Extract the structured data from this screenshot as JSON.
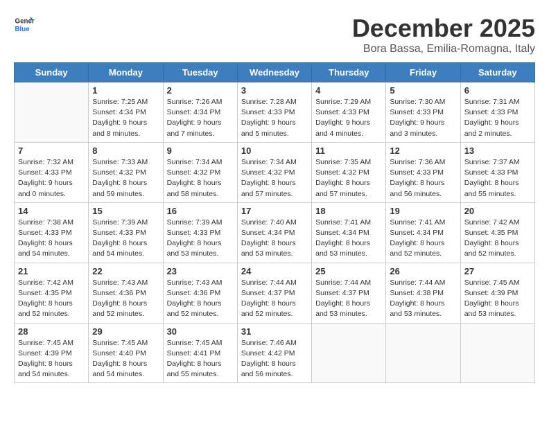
{
  "logo": {
    "line1": "General",
    "line2": "Blue"
  },
  "title": "December 2025",
  "subtitle": "Bora Bassa, Emilia-Romagna, Italy",
  "days_of_week": [
    "Sunday",
    "Monday",
    "Tuesday",
    "Wednesday",
    "Thursday",
    "Friday",
    "Saturday"
  ],
  "weeks": [
    [
      {
        "day": "",
        "info": ""
      },
      {
        "day": "1",
        "info": "Sunrise: 7:25 AM\nSunset: 4:34 PM\nDaylight: 9 hours\nand 8 minutes."
      },
      {
        "day": "2",
        "info": "Sunrise: 7:26 AM\nSunset: 4:34 PM\nDaylight: 9 hours\nand 7 minutes."
      },
      {
        "day": "3",
        "info": "Sunrise: 7:28 AM\nSunset: 4:33 PM\nDaylight: 9 hours\nand 5 minutes."
      },
      {
        "day": "4",
        "info": "Sunrise: 7:29 AM\nSunset: 4:33 PM\nDaylight: 9 hours\nand 4 minutes."
      },
      {
        "day": "5",
        "info": "Sunrise: 7:30 AM\nSunset: 4:33 PM\nDaylight: 9 hours\nand 3 minutes."
      },
      {
        "day": "6",
        "info": "Sunrise: 7:31 AM\nSunset: 4:33 PM\nDaylight: 9 hours\nand 2 minutes."
      }
    ],
    [
      {
        "day": "7",
        "info": "Sunrise: 7:32 AM\nSunset: 4:33 PM\nDaylight: 9 hours\nand 0 minutes."
      },
      {
        "day": "8",
        "info": "Sunrise: 7:33 AM\nSunset: 4:32 PM\nDaylight: 8 hours\nand 59 minutes."
      },
      {
        "day": "9",
        "info": "Sunrise: 7:34 AM\nSunset: 4:32 PM\nDaylight: 8 hours\nand 58 minutes."
      },
      {
        "day": "10",
        "info": "Sunrise: 7:34 AM\nSunset: 4:32 PM\nDaylight: 8 hours\nand 57 minutes."
      },
      {
        "day": "11",
        "info": "Sunrise: 7:35 AM\nSunset: 4:32 PM\nDaylight: 8 hours\nand 57 minutes."
      },
      {
        "day": "12",
        "info": "Sunrise: 7:36 AM\nSunset: 4:33 PM\nDaylight: 8 hours\nand 56 minutes."
      },
      {
        "day": "13",
        "info": "Sunrise: 7:37 AM\nSunset: 4:33 PM\nDaylight: 8 hours\nand 55 minutes."
      }
    ],
    [
      {
        "day": "14",
        "info": "Sunrise: 7:38 AM\nSunset: 4:33 PM\nDaylight: 8 hours\nand 54 minutes."
      },
      {
        "day": "15",
        "info": "Sunrise: 7:39 AM\nSunset: 4:33 PM\nDaylight: 8 hours\nand 54 minutes."
      },
      {
        "day": "16",
        "info": "Sunrise: 7:39 AM\nSunset: 4:33 PM\nDaylight: 8 hours\nand 53 minutes."
      },
      {
        "day": "17",
        "info": "Sunrise: 7:40 AM\nSunset: 4:34 PM\nDaylight: 8 hours\nand 53 minutes."
      },
      {
        "day": "18",
        "info": "Sunrise: 7:41 AM\nSunset: 4:34 PM\nDaylight: 8 hours\nand 53 minutes."
      },
      {
        "day": "19",
        "info": "Sunrise: 7:41 AM\nSunset: 4:34 PM\nDaylight: 8 hours\nand 52 minutes."
      },
      {
        "day": "20",
        "info": "Sunrise: 7:42 AM\nSunset: 4:35 PM\nDaylight: 8 hours\nand 52 minutes."
      }
    ],
    [
      {
        "day": "21",
        "info": "Sunrise: 7:42 AM\nSunset: 4:35 PM\nDaylight: 8 hours\nand 52 minutes."
      },
      {
        "day": "22",
        "info": "Sunrise: 7:43 AM\nSunset: 4:36 PM\nDaylight: 8 hours\nand 52 minutes."
      },
      {
        "day": "23",
        "info": "Sunrise: 7:43 AM\nSunset: 4:36 PM\nDaylight: 8 hours\nand 52 minutes."
      },
      {
        "day": "24",
        "info": "Sunrise: 7:44 AM\nSunset: 4:37 PM\nDaylight: 8 hours\nand 52 minutes."
      },
      {
        "day": "25",
        "info": "Sunrise: 7:44 AM\nSunset: 4:37 PM\nDaylight: 8 hours\nand 53 minutes."
      },
      {
        "day": "26",
        "info": "Sunrise: 7:44 AM\nSunset: 4:38 PM\nDaylight: 8 hours\nand 53 minutes."
      },
      {
        "day": "27",
        "info": "Sunrise: 7:45 AM\nSunset: 4:39 PM\nDaylight: 8 hours\nand 53 minutes."
      }
    ],
    [
      {
        "day": "28",
        "info": "Sunrise: 7:45 AM\nSunset: 4:39 PM\nDaylight: 8 hours\nand 54 minutes."
      },
      {
        "day": "29",
        "info": "Sunrise: 7:45 AM\nSunset: 4:40 PM\nDaylight: 8 hours\nand 54 minutes."
      },
      {
        "day": "30",
        "info": "Sunrise: 7:45 AM\nSunset: 4:41 PM\nDaylight: 8 hours\nand 55 minutes."
      },
      {
        "day": "31",
        "info": "Sunrise: 7:46 AM\nSunset: 4:42 PM\nDaylight: 8 hours\nand 56 minutes."
      },
      {
        "day": "",
        "info": ""
      },
      {
        "day": "",
        "info": ""
      },
      {
        "day": "",
        "info": ""
      }
    ]
  ]
}
